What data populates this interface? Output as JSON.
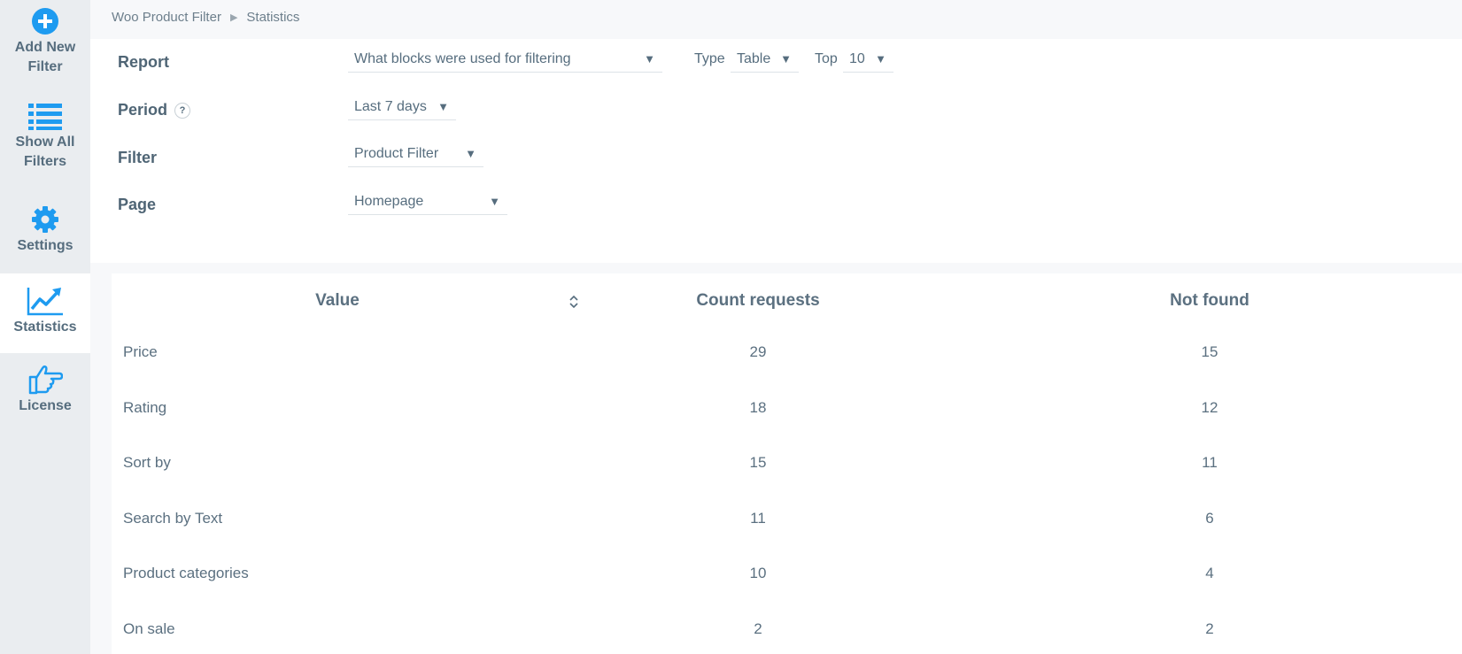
{
  "sidebar": {
    "items": [
      {
        "label": "Add New Filter",
        "icon": "plus-circle-icon"
      },
      {
        "label": "Show All Filters",
        "icon": "list-icon"
      },
      {
        "label": "Settings",
        "icon": "gear-icon"
      },
      {
        "label": "Statistics",
        "icon": "trend-chart-icon",
        "active": true
      },
      {
        "label": "License",
        "icon": "thumb-pointer-icon"
      }
    ]
  },
  "breadcrumb": {
    "root": "Woo Product Filter",
    "current": "Statistics"
  },
  "form": {
    "report": {
      "label": "Report",
      "value": "What blocks were used for filtering"
    },
    "type": {
      "label": "Type",
      "value": "Table"
    },
    "top": {
      "label": "Top",
      "value": "10"
    },
    "period": {
      "label": "Period",
      "value": "Last 7 days",
      "help": "?"
    },
    "filter": {
      "label": "Filter",
      "value": "Product Filter"
    },
    "page": {
      "label": "Page",
      "value": "Homepage"
    }
  },
  "table": {
    "columns": [
      "Value",
      "Count requests",
      "Not found"
    ],
    "rows": [
      {
        "value": "Price",
        "count": "29",
        "not_found": "15"
      },
      {
        "value": "Rating",
        "count": "18",
        "not_found": "12"
      },
      {
        "value": "Sort by",
        "count": "15",
        "not_found": "11"
      },
      {
        "value": "Search by Text",
        "count": "11",
        "not_found": "6"
      },
      {
        "value": "Product categories",
        "count": "10",
        "not_found": "4"
      },
      {
        "value": "On sale",
        "count": "2",
        "not_found": "2"
      }
    ]
  },
  "colors": {
    "accent": "#1e9bf0",
    "sidebar_bg": "#eaedf0",
    "text": "#566d7e"
  }
}
